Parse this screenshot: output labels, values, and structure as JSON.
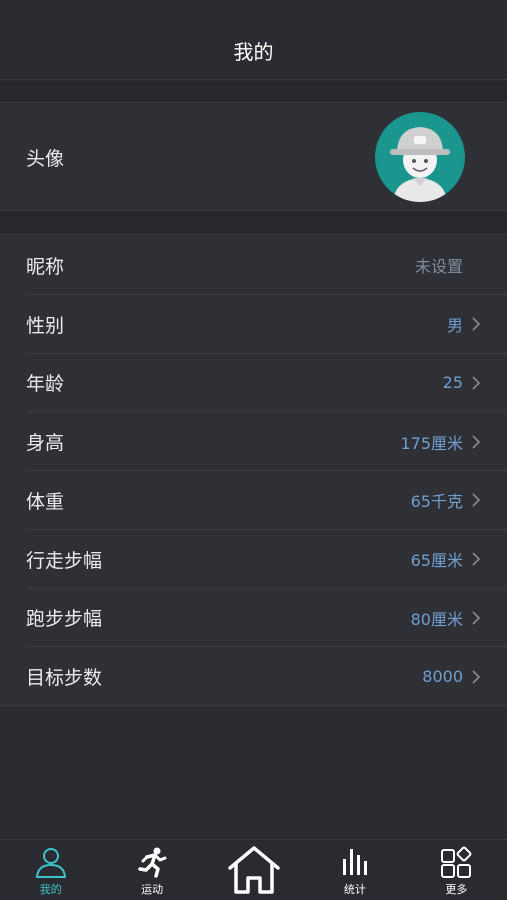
{
  "header": {
    "title": "我的"
  },
  "avatar_row": {
    "label": "头像"
  },
  "rows": [
    {
      "label": "昵称",
      "value": "未设置"
    },
    {
      "label": "性别",
      "value": "男"
    },
    {
      "label": "年龄",
      "value": "25"
    },
    {
      "label": "身高",
      "value": "175厘米"
    },
    {
      "label": "体重",
      "value": "65千克"
    },
    {
      "label": "行走步幅",
      "value": "65厘米"
    },
    {
      "label": "跑步步幅",
      "value": "80厘米"
    },
    {
      "label": "目标步数",
      "value": "8000"
    }
  ],
  "tabbar": {
    "tabs": [
      {
        "label": "我的",
        "icon": "person-icon",
        "active": true
      },
      {
        "label": "运动",
        "icon": "runner-icon"
      },
      {
        "label": "",
        "icon": "home-icon"
      },
      {
        "label": "统计",
        "icon": "bar-chart-icon"
      },
      {
        "label": "更多",
        "icon": "grid-icon"
      }
    ]
  },
  "colors": {
    "accent": "#3dc3c9",
    "value": "#6f9fd0",
    "background": "#2b2c31",
    "avatar_bg": "#1a968f"
  }
}
